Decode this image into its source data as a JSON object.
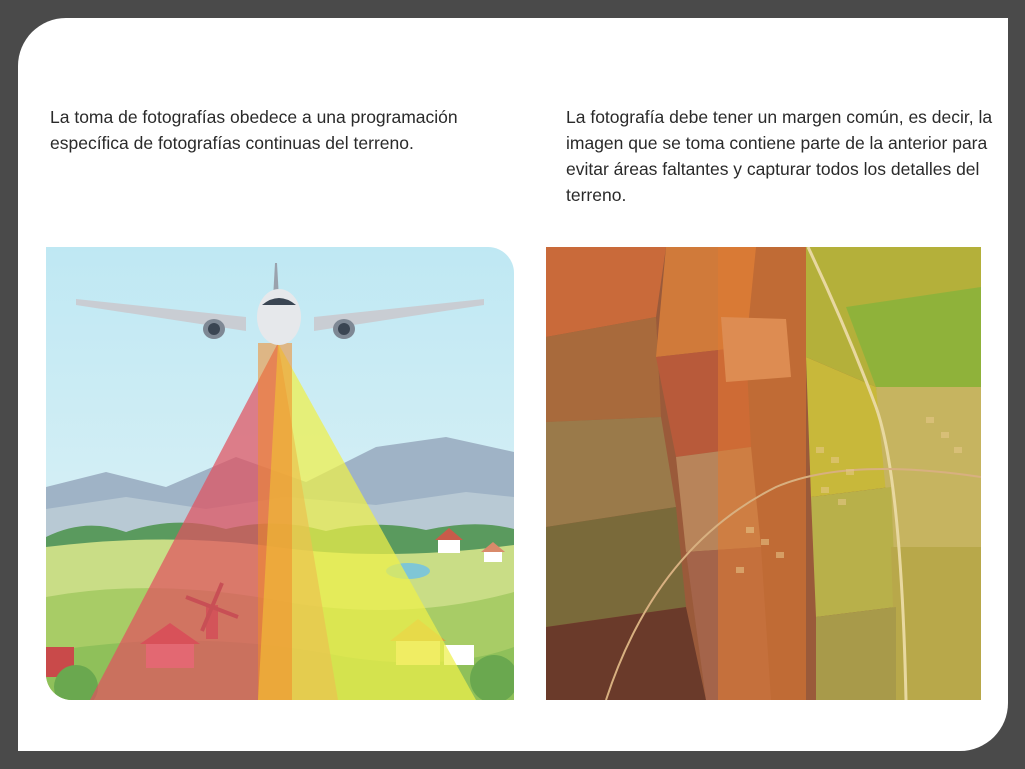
{
  "captions": {
    "left": "La toma de fotografías obedece a una programación específica de fotografías continuas del terreno.",
    "right": "La fotografía debe tener un margen común, es decir, la imagen que se toma contiene parte de la anterior para evitar áreas faltantes y capturar todos los detalles del terreno."
  },
  "colors": {
    "frame": "#4a4a4a",
    "card": "#ffffff",
    "text": "#2a2a2a",
    "cone_red": "#e0525f",
    "cone_yellow": "#eef04a",
    "overlap_orange": "#f08a2a"
  },
  "illustrations": {
    "left": "airplane-aerial-photography-cones",
    "right": "aerial-photo-mosaic-overlap"
  }
}
